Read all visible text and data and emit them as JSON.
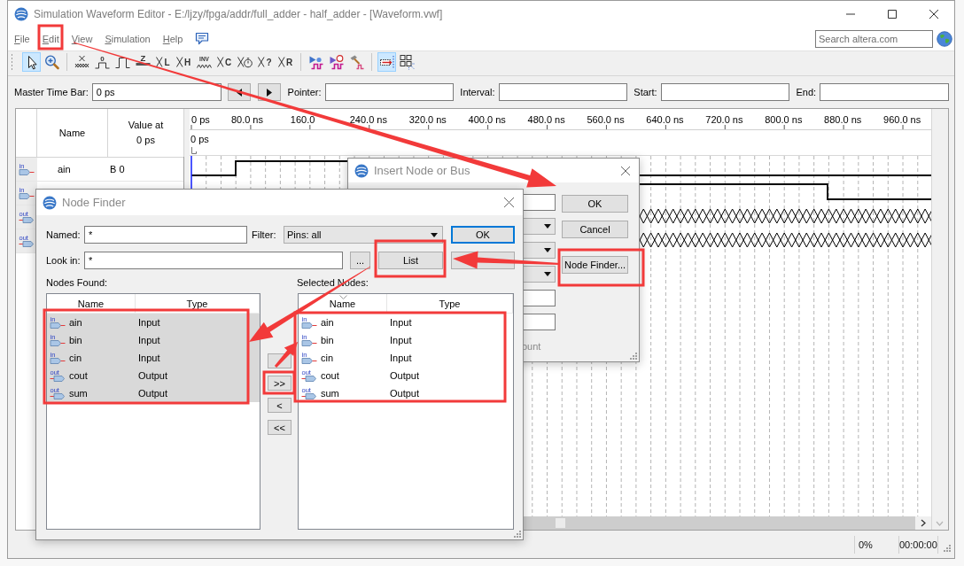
{
  "window": {
    "title": "Simulation Waveform Editor - E:/ljzy/fpga/addr/full_adder - half_adder - [Waveform.vwf]"
  },
  "menu": [
    "File",
    "Edit",
    "View",
    "Simulation",
    "Help"
  ],
  "search": {
    "placeholder": "Search altera.com"
  },
  "toolbar": [
    {
      "buttons": [
        {
          "kind": "pointer",
          "selected": true
        },
        {
          "kind": "zoom",
          "selected": false
        }
      ]
    },
    {
      "buttons": [
        {
          "kind": "unknown",
          "selected": false
        },
        {
          "kind": "low",
          "glyph": "0",
          "selected": false
        },
        {
          "kind": "high",
          "selected": false
        },
        {
          "kind": "highz",
          "glyph": "Z",
          "selected": false
        },
        {
          "kind": "value",
          "glyph": "L",
          "selected": false
        },
        {
          "kind": "value",
          "glyph": "H",
          "selected": false
        },
        {
          "kind": "invert",
          "glyph": "INV",
          "selected": false
        },
        {
          "kind": "value",
          "glyph": "C",
          "selected": false
        },
        {
          "kind": "clock",
          "selected": false
        },
        {
          "kind": "value",
          "glyph": "?",
          "selected": false
        },
        {
          "kind": "value",
          "glyph": "R",
          "selected": false
        }
      ]
    },
    {
      "buttons": [
        {
          "kind": "functional",
          "selected": false
        },
        {
          "kind": "timing",
          "selected": false
        },
        {
          "kind": "netlist",
          "selected": false
        }
      ]
    },
    {
      "buttons": [
        {
          "kind": "snap",
          "selected": true
        },
        {
          "kind": "grid",
          "selected": false
        }
      ]
    }
  ],
  "time_bar": {
    "fields": [
      {
        "label": "Master Time Bar:",
        "value": "0 ps"
      },
      {
        "label": "Pointer:"
      },
      {
        "label": "Interval:"
      },
      {
        "label": "Start:"
      },
      {
        "label": "End:"
      }
    ],
    "nav_buttons": [
      {
        "kind": "previous"
      },
      {
        "kind": "next"
      }
    ]
  },
  "waveform": {
    "columns": [
      "Name",
      "Value at\n0 ps"
    ],
    "signals": [
      {
        "kind": "input",
        "pin": "in",
        "name": "ain",
        "value": "B 0"
      },
      {
        "kind": "input",
        "pin": "in"
      },
      {
        "kind": "output",
        "pin": "out"
      },
      {
        "kind": "output",
        "pin": "out"
      }
    ],
    "ruler": [
      "0 ps",
      "80.0 ns",
      "160.0",
      "240.0 ns",
      "320.0 ns",
      "400.0 ns",
      "480.0 ns",
      "560.0 ns",
      "640.0 ns",
      "720.0 ns",
      "800.0 ns",
      "880.0 ns",
      "960.0 ns"
    ],
    "cursor": "0 ps"
  },
  "status_bar": {
    "progress": "0%",
    "elapsed": "00:00:00"
  },
  "insert_dialog": {
    "title": "Insert Node or Bus",
    "fields": [
      {
        "kind": "text"
      },
      {
        "kind": "dropdown"
      },
      {
        "kind": "dropdown"
      },
      {
        "kind": "dropdown"
      },
      {
        "kind": "text"
      },
      {
        "kind": "text"
      }
    ],
    "partial_label": "ount",
    "buttons": [
      "OK",
      "Cancel",
      "Node Finder..."
    ]
  },
  "node_finder": {
    "title": "Node Finder",
    "named": {
      "label": "Named:",
      "value": "*"
    },
    "filter": {
      "label": "Filter:",
      "value": "Pins: all"
    },
    "look_in": {
      "label": "Look in:",
      "value": "*"
    },
    "browse": "...",
    "buttons": [
      {
        "label": "OK",
        "focused": true
      },
      {
        "label": "List",
        "focused": false
      },
      {
        "focused": false
      }
    ],
    "nodes_found": {
      "label": "Nodes Found:",
      "columns": [
        {
          "label": "Name",
          "sorted": false
        },
        {
          "label": "Type",
          "sorted": false
        }
      ],
      "rows": [
        {
          "kind": "input",
          "pin": "in",
          "name": "ain",
          "type": "Input",
          "selected": true
        },
        {
          "kind": "input",
          "pin": "in",
          "name": "bin",
          "type": "Input",
          "selected": true
        },
        {
          "kind": "input",
          "pin": "in",
          "name": "cin",
          "type": "Input",
          "selected": true
        },
        {
          "kind": "output",
          "pin": "out",
          "name": "cout",
          "type": "Output",
          "selected": true
        },
        {
          "kind": "output",
          "pin": "out",
          "name": "sum",
          "type": "Output",
          "selected": true
        }
      ]
    },
    "transfer": [
      {
        "kind": "button"
      },
      {
        "kind": "button",
        "label": ">>"
      },
      {
        "kind": "button",
        "label": "<"
      },
      {
        "kind": "button",
        "label": "<<"
      }
    ],
    "selected_nodes": {
      "label": "Selected Nodes:",
      "columns": [
        {
          "label": "Name",
          "sorted": true
        },
        {
          "label": "Type",
          "sorted": false
        }
      ],
      "rows": [
        {
          "kind": "input",
          "pin": "in",
          "name": "ain",
          "type": "Input",
          "selected": false
        },
        {
          "kind": "input",
          "pin": "in",
          "name": "bin",
          "type": "Input",
          "selected": false
        },
        {
          "kind": "input",
          "pin": "in",
          "name": "cin",
          "type": "Input",
          "selected": false
        },
        {
          "kind": "output",
          "pin": "out",
          "name": "cout",
          "type": "Output",
          "selected": false
        },
        {
          "kind": "output",
          "pin": "out",
          "name": "sum",
          "type": "Output",
          "selected": false
        }
      ]
    }
  },
  "annotations": [
    {
      "kind": "frame"
    },
    {
      "kind": "arrow"
    },
    {
      "kind": "frame"
    },
    {
      "kind": "frame"
    },
    {
      "kind": "arrow"
    },
    {
      "kind": "arrow"
    },
    {
      "kind": "frame"
    },
    {
      "kind": "frame"
    },
    {
      "kind": "arrow"
    },
    {
      "kind": "frame"
    }
  ]
}
